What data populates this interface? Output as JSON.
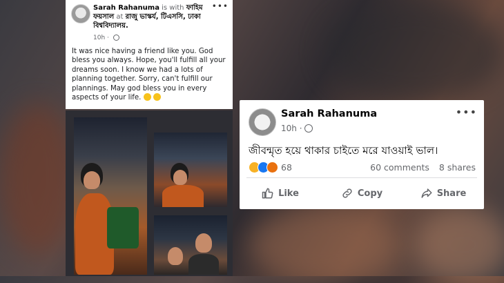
{
  "left_post": {
    "author": "Sarah Rahanuma",
    "with_text": "is with",
    "tagged": "ফাহিম ফয়সাল",
    "at_text": "at",
    "location": "রাজু ভাস্কর্য, টিএসসি, ঢাকা বিশ্ববিদ্যালয়.",
    "time": "10h ·",
    "body": "It was nice having a friend like you. God bless you always. Hope, you'll fulfill all your dreams soon. I know we had a lots of planning together. Sorry, can't fulfill our plannings. May god bless you in every aspects of your life."
  },
  "right_post": {
    "author": "Sarah Rahanuma",
    "time": "10h ·",
    "body": "জীবন্মৃত হয়ে থাকার চাইতে মরে যাওয়াই ভাল।",
    "reaction_count": "68",
    "comments": "60 comments",
    "shares": "8 shares",
    "actions": {
      "like": "Like",
      "copy": "Copy",
      "share": "Share"
    }
  },
  "icons": [
    "globe-icon",
    "more-options-icon",
    "like-icon",
    "copy-icon",
    "share-icon",
    "sad-reaction-icon",
    "like-reaction-icon",
    "angry-reaction-icon",
    "heart-emoji-icon"
  ],
  "colors": {
    "card_bg": "#ffffff",
    "text_secondary": "#65676b",
    "like_blue": "#1877f2"
  }
}
